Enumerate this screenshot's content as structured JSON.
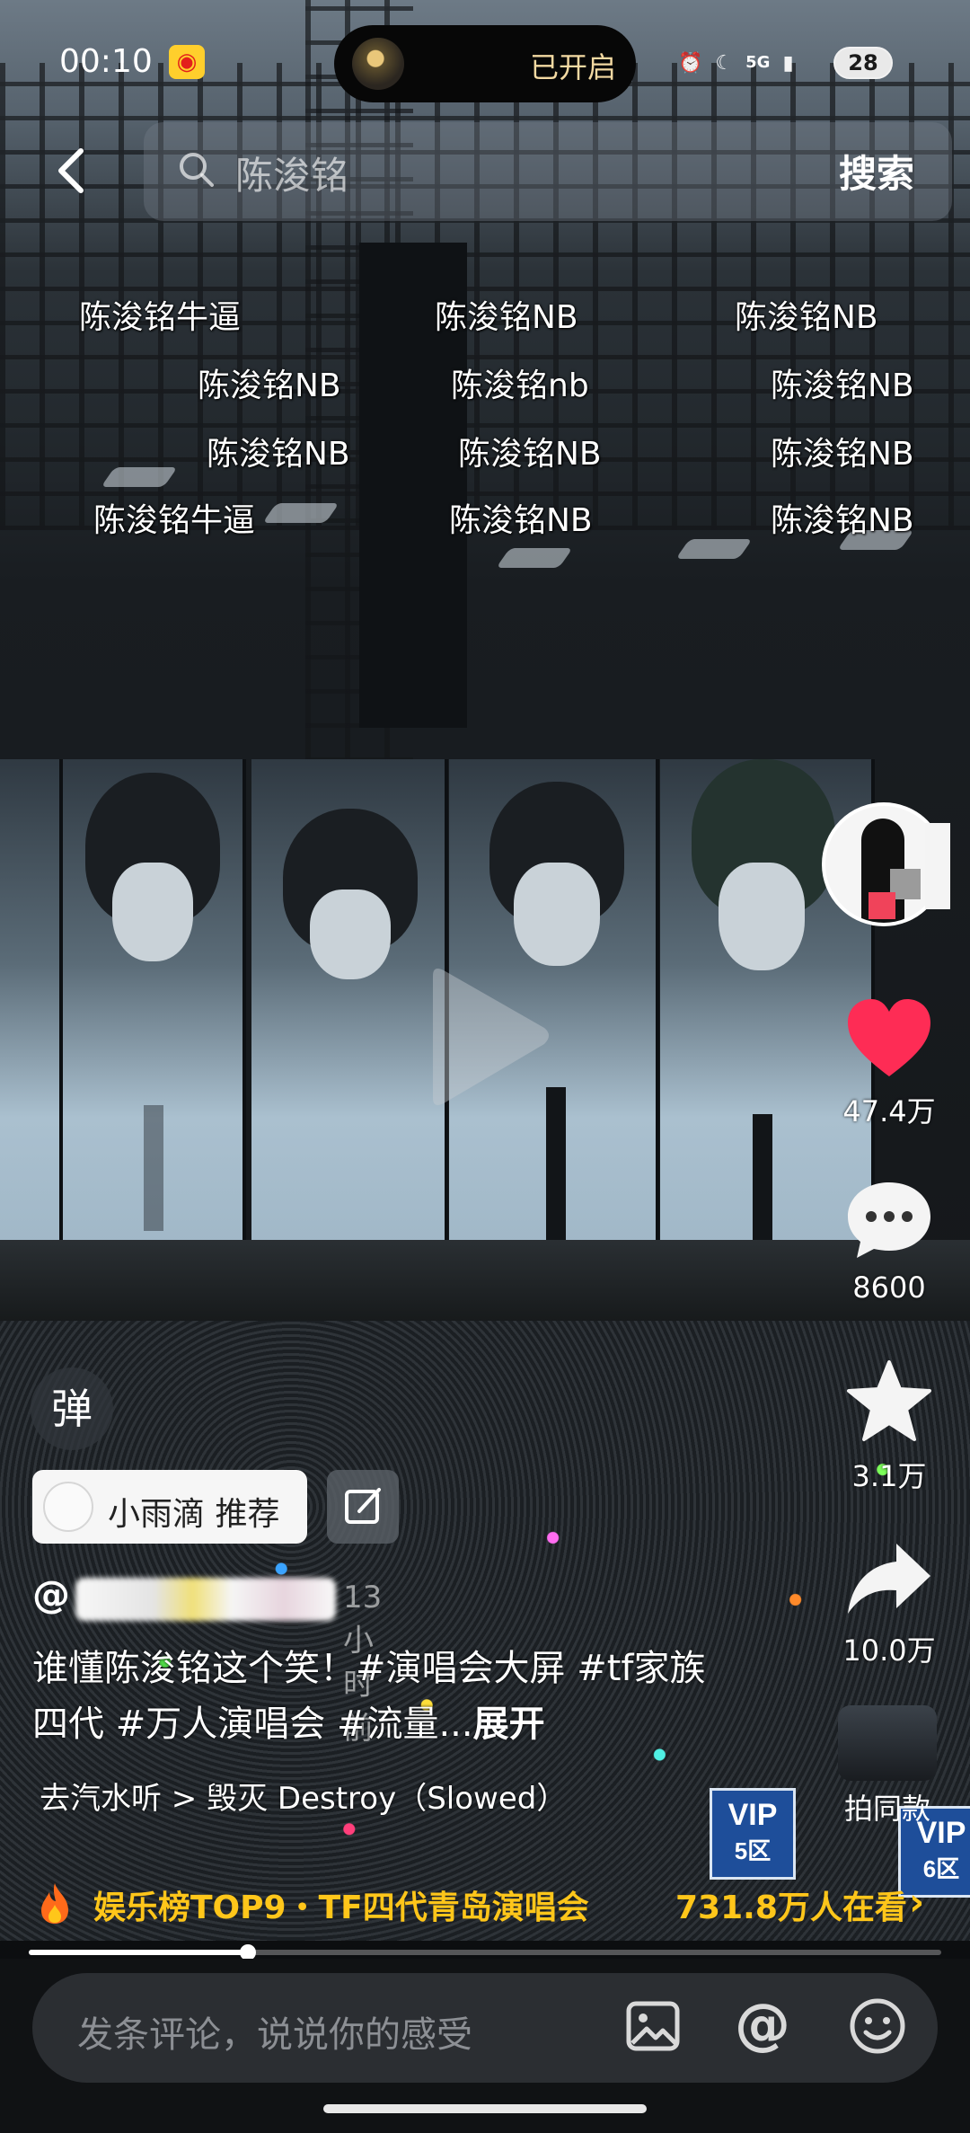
{
  "status_bar": {
    "time": "00:10",
    "flashlight_label": "已开启",
    "network": "5G",
    "battery": "28"
  },
  "search": {
    "query": "陈浚铭",
    "button_label": "搜索"
  },
  "danmaku": [
    "陈浚铭牛逼",
    "陈浚铭NB",
    "陈浚铭NB",
    "陈浚铭NB",
    "陈浚铭nb",
    "陈浚铭NB",
    "陈浚铭NB",
    "陈浚铭NB",
    "陈浚铭NB",
    "陈浚铭牛逼",
    "陈浚铭NB",
    "陈浚铭NB"
  ],
  "right_rail": {
    "likes": "47.4万",
    "comments": "8600",
    "favorites": "3.1万",
    "shares": "10.0万",
    "remix_label": "拍同款"
  },
  "danmaku_toggle_label": "弹",
  "recommender": {
    "label": "小雨滴 推荐"
  },
  "post": {
    "at_symbol": "@",
    "time": "13小时前",
    "caption": "谁懂陈浚铭这个笑！#演唱会大屏 #tf家族四代 #万人演唱会 #流量...",
    "expand_label": "展开",
    "music": "去汽水听 > 毁灭 Destroy（Slowed）"
  },
  "trending": {
    "label": "娱乐榜TOP9・TF四代青岛演唱会",
    "viewers": "731.8万人在看",
    "chevron": "›"
  },
  "playback": {
    "progress_fraction": 0.24
  },
  "comment_bar": {
    "placeholder": "发条评论，说说你的感受",
    "at_label": "@"
  },
  "colors": {
    "like_red": "#fe2c55",
    "trend_gold": "#ffc61a"
  }
}
